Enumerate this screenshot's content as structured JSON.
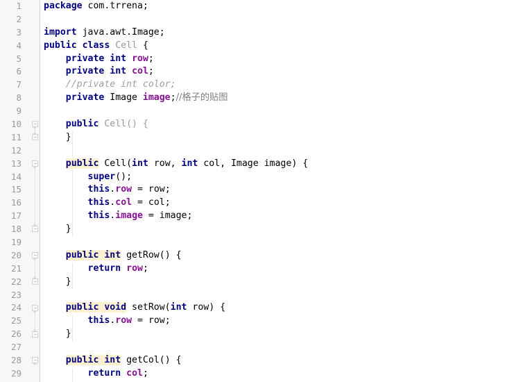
{
  "editor": {
    "language": "java",
    "colors": {
      "background": "#ffffff",
      "gutter_background": "#f7f7f7",
      "gutter_divider": "#d0d0d0",
      "line_number": "#999999",
      "keyword": "#000080",
      "field": "#871094",
      "comment": "#a0a0a0",
      "dimmed_identifier": "#999999",
      "occurrence_highlight": "#fbf0d0",
      "indent_guide": "#e8e8e8"
    },
    "line_numbers": [
      1,
      2,
      3,
      4,
      5,
      6,
      7,
      8,
      9,
      10,
      11,
      12,
      13,
      14,
      15,
      16,
      17,
      18,
      19,
      20,
      21,
      22,
      23,
      24,
      25,
      26,
      27,
      28,
      29
    ],
    "fold_markers": [
      {
        "line": 10,
        "type": "region-start"
      },
      {
        "line": 11,
        "type": "region-end"
      },
      {
        "line": 13,
        "type": "region-start"
      },
      {
        "line": 18,
        "type": "region-end"
      },
      {
        "line": 20,
        "type": "region-start"
      },
      {
        "line": 22,
        "type": "region-end"
      },
      {
        "line": 24,
        "type": "region-start"
      },
      {
        "line": 26,
        "type": "region-end"
      },
      {
        "line": 28,
        "type": "region-start"
      }
    ],
    "lines": [
      {
        "n": 1,
        "text": "package com.trrena;"
      },
      {
        "n": 2,
        "text": ""
      },
      {
        "n": 3,
        "text": "import java.awt.Image;"
      },
      {
        "n": 4,
        "text": "public class Cell {"
      },
      {
        "n": 5,
        "text": "    private int row;"
      },
      {
        "n": 6,
        "text": "    private int col;"
      },
      {
        "n": 7,
        "text": "    //private int color;"
      },
      {
        "n": 8,
        "text": "    private Image image;//格子的贴图"
      },
      {
        "n": 9,
        "text": ""
      },
      {
        "n": 10,
        "text": "    public Cell() {"
      },
      {
        "n": 11,
        "text": "    }"
      },
      {
        "n": 12,
        "text": ""
      },
      {
        "n": 13,
        "text": "    public Cell(int row, int col, Image image) {"
      },
      {
        "n": 14,
        "text": "        super();"
      },
      {
        "n": 15,
        "text": "        this.row = row;"
      },
      {
        "n": 16,
        "text": "        this.col = col;"
      },
      {
        "n": 17,
        "text": "        this.image = image;"
      },
      {
        "n": 18,
        "text": "    }"
      },
      {
        "n": 19,
        "text": ""
      },
      {
        "n": 20,
        "text": "    public int getRow() {"
      },
      {
        "n": 21,
        "text": "        return row;"
      },
      {
        "n": 22,
        "text": "    }"
      },
      {
        "n": 23,
        "text": ""
      },
      {
        "n": 24,
        "text": "    public void setRow(int row) {"
      },
      {
        "n": 25,
        "text": "        this.row = row;"
      },
      {
        "n": 26,
        "text": "    }"
      },
      {
        "n": 27,
        "text": ""
      },
      {
        "n": 28,
        "text": "    public int getCol() {"
      },
      {
        "n": 29,
        "text": "        return col;"
      }
    ],
    "tokens": {
      "l1": [
        {
          "t": "package",
          "c": "kw"
        },
        {
          "t": " com.trrena;",
          "c": "ident"
        }
      ],
      "l3": [
        {
          "t": "import",
          "c": "kw"
        },
        {
          "t": " java.awt.Image;",
          "c": "ident"
        }
      ],
      "l4": [
        {
          "t": "public class",
          "c": "kw"
        },
        {
          "t": " ",
          "c": "ident"
        },
        {
          "t": "Cell",
          "c": "dim"
        },
        {
          "t": " {",
          "c": "ident"
        }
      ],
      "l5": [
        {
          "t": "    ",
          "c": "ident"
        },
        {
          "t": "private int",
          "c": "kw"
        },
        {
          "t": " ",
          "c": "ident"
        },
        {
          "t": "row",
          "c": "field"
        },
        {
          "t": ";",
          "c": "ident"
        }
      ],
      "l6": [
        {
          "t": "    ",
          "c": "ident"
        },
        {
          "t": "private int",
          "c": "kw"
        },
        {
          "t": " ",
          "c": "ident"
        },
        {
          "t": "col",
          "c": "field"
        },
        {
          "t": ";",
          "c": "ident"
        }
      ],
      "l7": [
        {
          "t": "    ",
          "c": "ident"
        },
        {
          "t": "//private int color;",
          "c": "comment"
        }
      ],
      "l8": [
        {
          "t": "    ",
          "c": "ident"
        },
        {
          "t": "private",
          "c": "kw"
        },
        {
          "t": " Image ",
          "c": "ident"
        },
        {
          "t": "image",
          "c": "field"
        },
        {
          "t": ";",
          "c": "ident"
        },
        {
          "t": "//",
          "c": "cjk"
        },
        {
          "t": "格子的贴图",
          "c": "cjk"
        }
      ],
      "l10": [
        {
          "t": "    ",
          "c": "ident"
        },
        {
          "t": "public",
          "c": "kw"
        },
        {
          "t": " ",
          "c": "ident"
        },
        {
          "t": "Cell() {",
          "c": "dim"
        }
      ],
      "l11": [
        {
          "t": "    }",
          "c": "ident"
        }
      ],
      "l13": [
        {
          "t": "    ",
          "c": "ident"
        },
        {
          "t": "public",
          "c": "kw hl"
        },
        {
          "t": " Cell(",
          "c": "ident"
        },
        {
          "t": "int",
          "c": "kw"
        },
        {
          "t": " row, ",
          "c": "ident"
        },
        {
          "t": "int",
          "c": "kw"
        },
        {
          "t": " col, Image image) {",
          "c": "ident"
        }
      ],
      "l14": [
        {
          "t": "        ",
          "c": "ident"
        },
        {
          "t": "super",
          "c": "kw"
        },
        {
          "t": "();",
          "c": "ident"
        }
      ],
      "l15": [
        {
          "t": "        ",
          "c": "ident"
        },
        {
          "t": "this",
          "c": "kw"
        },
        {
          "t": ".",
          "c": "ident"
        },
        {
          "t": "row",
          "c": "field"
        },
        {
          "t": " = row;",
          "c": "ident"
        }
      ],
      "l16": [
        {
          "t": "        ",
          "c": "ident"
        },
        {
          "t": "this",
          "c": "kw"
        },
        {
          "t": ".",
          "c": "ident"
        },
        {
          "t": "col",
          "c": "field"
        },
        {
          "t": " = col;",
          "c": "ident"
        }
      ],
      "l17": [
        {
          "t": "        ",
          "c": "ident"
        },
        {
          "t": "this",
          "c": "kw"
        },
        {
          "t": ".",
          "c": "ident"
        },
        {
          "t": "image",
          "c": "field"
        },
        {
          "t": " = image;",
          "c": "ident"
        }
      ],
      "l18": [
        {
          "t": "    }",
          "c": "ident"
        }
      ],
      "l20": [
        {
          "t": "    ",
          "c": "ident"
        },
        {
          "t": "public int",
          "c": "kw hl"
        },
        {
          "t": " getRow() {",
          "c": "ident"
        }
      ],
      "l21": [
        {
          "t": "        ",
          "c": "ident"
        },
        {
          "t": "return",
          "c": "kw"
        },
        {
          "t": " ",
          "c": "ident"
        },
        {
          "t": "row",
          "c": "field"
        },
        {
          "t": ";",
          "c": "ident"
        }
      ],
      "l22": [
        {
          "t": "    }",
          "c": "ident"
        }
      ],
      "l24": [
        {
          "t": "    ",
          "c": "ident"
        },
        {
          "t": "public void",
          "c": "kw hl"
        },
        {
          "t": " setRow(",
          "c": "ident"
        },
        {
          "t": "int",
          "c": "kw"
        },
        {
          "t": " row) {",
          "c": "ident"
        }
      ],
      "l25": [
        {
          "t": "        ",
          "c": "ident"
        },
        {
          "t": "this",
          "c": "kw"
        },
        {
          "t": ".",
          "c": "ident"
        },
        {
          "t": "row",
          "c": "field"
        },
        {
          "t": " = row;",
          "c": "ident"
        }
      ],
      "l26": [
        {
          "t": "    }",
          "c": "ident"
        }
      ],
      "l28": [
        {
          "t": "    ",
          "c": "ident"
        },
        {
          "t": "public int",
          "c": "kw hl"
        },
        {
          "t": " getCol() {",
          "c": "ident"
        }
      ],
      "l29": [
        {
          "t": "        ",
          "c": "ident"
        },
        {
          "t": "return",
          "c": "kw"
        },
        {
          "t": " ",
          "c": "ident"
        },
        {
          "t": "col",
          "c": "field"
        },
        {
          "t": ";",
          "c": "ident"
        }
      ]
    }
  }
}
